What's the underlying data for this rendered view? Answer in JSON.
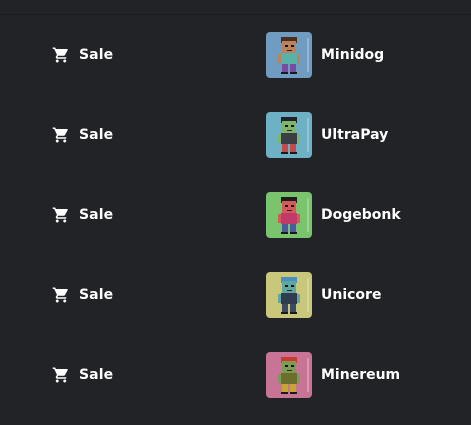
{
  "rows": [
    {
      "event": "Sale",
      "event_icon": "cart-icon",
      "item_name": "Minidog",
      "thumb_bg": "#6f9cc0",
      "character": {
        "skin": "#b9835f",
        "hair": "#4a2f1e",
        "shirt": "#5ab1a6",
        "pants": "#7a4ba3"
      }
    },
    {
      "event": "Sale",
      "event_icon": "cart-icon",
      "item_name": "UltraPay",
      "thumb_bg": "#6eb0c4",
      "character": {
        "skin": "#7fb56a",
        "hair": "#20232a",
        "shirt": "#3a3f46",
        "pants": "#c24b4b"
      }
    },
    {
      "event": "Sale",
      "event_icon": "cart-icon",
      "item_name": "Dogebonk",
      "thumb_bg": "#79c46d",
      "character": {
        "skin": "#d35a5a",
        "hair": "#1d1d1d",
        "shirt": "#c23a6a",
        "pants": "#4a5a9c"
      }
    },
    {
      "event": "Sale",
      "event_icon": "cart-icon",
      "item_name": "Unicore",
      "thumb_bg": "#c8c77a",
      "character": {
        "skin": "#5fa7a0",
        "hair": "#4b8fc0",
        "shirt": "#2f3d4f",
        "pants": "#3b4a62"
      }
    },
    {
      "event": "Sale",
      "event_icon": "cart-icon",
      "item_name": "Minereum",
      "thumb_bg": "#c87496",
      "character": {
        "skin": "#7e9b55",
        "hair": "#c93a2f",
        "shirt": "#6a6f2e",
        "pants": "#c7a62f"
      }
    }
  ]
}
